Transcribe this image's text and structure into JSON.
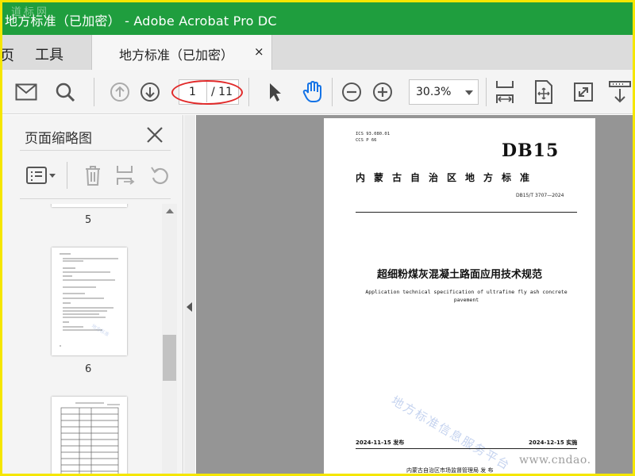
{
  "window": {
    "title": "地方标准（已加密） - Adobe Acrobat Pro DC",
    "watermark": "道标网"
  },
  "tabs": {
    "home_fragment": "页",
    "tools": "工具",
    "document": "地方标准（已加密）",
    "close": "×"
  },
  "toolbar": {
    "current_page": "1",
    "total_pages": "/ 11",
    "zoom": "30.3%",
    "icons": [
      "mail-icon",
      "search-icon",
      "arrow-up-icon",
      "arrow-down-icon",
      "select-cursor-icon",
      "hand-icon",
      "zoom-out-icon",
      "zoom-in-icon",
      "fit-page-icon",
      "rotate-fit-icon",
      "fullscreen-icon",
      "scroll-mode-icon"
    ],
    "annotation_color": "#e12a2a"
  },
  "panel": {
    "title": "页面缩略图",
    "thumbnails": [
      {
        "label": "5"
      },
      {
        "label": "6"
      }
    ]
  },
  "document": {
    "ics": "ICS  93.080.01",
    "ccs": "CCS P 66",
    "db_mark": "DB15",
    "standard_region": "内蒙古自治区地方标准",
    "standard_code": "DB15/T 3707—2024",
    "title_cn": "超细粉煤灰混凝土路面应用技术规范",
    "title_en": "Application technical specification of ultrafine fly ash concrete pavement",
    "watermark": "地方标准信息服务平台",
    "publish_date": "2024-11-15 发布",
    "implement_date": "2024-12-15 实施",
    "issuer": "内蒙古自治区市场监督管理局    发 布"
  },
  "site_watermark": "www.cndao.",
  "colors": {
    "titlebar": "#1f9e3e",
    "frame": "#f5e600",
    "tool_blue": "#1473e6"
  }
}
